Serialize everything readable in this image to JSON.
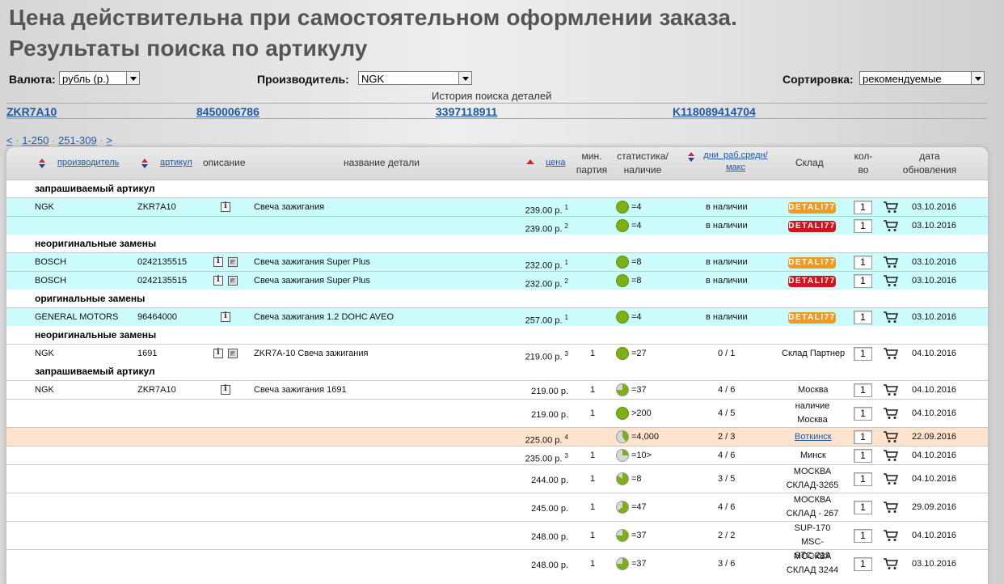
{
  "page": {
    "title_line1": "Цена действительна при самостоятельном оформлении заказа.",
    "title_line2": "Результаты поиска по артикулу"
  },
  "filters": {
    "currency_label": "Валюта:",
    "currency_value": "рубль (р.)",
    "manufacturer_label": "Производитель:",
    "manufacturer_value": "NGK",
    "sort_label": "Сортировка:",
    "sort_value": "рекомендуемые"
  },
  "history": {
    "title": "История поиска деталей",
    "items": [
      "ZKR7A10",
      "8450006786",
      "3397118911",
      "K118089414704"
    ]
  },
  "pager": {
    "prev": "<",
    "sep": "·",
    "pages": [
      "1-250",
      "251-309"
    ],
    "next": ">"
  },
  "table": {
    "headers": {
      "manufacturer": "производитель",
      "article": "артикул",
      "description": "описание",
      "name": "название детали",
      "price": "цена",
      "min_lot_1": "мин.",
      "min_lot_2": "партия",
      "stats_1": "статистика/",
      "stats_2": "наличие",
      "days_1": "дни_раб.средн/",
      "days_2": "макс",
      "warehouse": "Склад",
      "qty_1": "кол-",
      "qty_2": "во",
      "date_1": "дата",
      "date_2": "обновления"
    },
    "groups": [
      "запрашиваемый артикул",
      "неоригинальные замены",
      "оригинальные замены",
      "неоригинальные замены",
      "запрашиваемый артикул"
    ],
    "rows": [
      {
        "mfr": "NGK",
        "art": "ZKR7A10",
        "name": "Свеча зажигания",
        "price": "239.00 р.",
        "sup": "1",
        "lot": "",
        "stat": "=4",
        "days": "в наличии",
        "wh": "DETALI77",
        "qty": "1",
        "date": "03.10.2016"
      },
      {
        "mfr": "",
        "art": "",
        "name": "",
        "price": "239.00 р.",
        "sup": "2",
        "lot": "",
        "stat": "=4",
        "days": "в наличии",
        "wh": "DETALI77",
        "qty": "1",
        "date": "03.10.2016"
      },
      {
        "mfr": "BOSCH",
        "art": "0242135515",
        "name": "Свеча зажигания Super Plus",
        "price": "232.00 р.",
        "sup": "1",
        "lot": "",
        "stat": "=8",
        "days": "в наличии",
        "wh": "DETALI77",
        "qty": "1",
        "date": "03.10.2016"
      },
      {
        "mfr": "BOSCH",
        "art": "0242135515",
        "name": "Свеча зажигания Super Plus",
        "price": "232.00 р.",
        "sup": "2",
        "lot": "",
        "stat": "=8",
        "days": "в наличии",
        "wh": "DETALI77",
        "qty": "1",
        "date": "03.10.2016"
      },
      {
        "mfr": "GENERAL MOTORS",
        "art": "96464000",
        "name": "Свеча зажигания 1.2 DOHC AVEO",
        "price": "257.00 р.",
        "sup": "1",
        "lot": "",
        "stat": "=4",
        "days": "в наличии",
        "wh": "DETALI77",
        "qty": "1",
        "date": "03.10.2016"
      },
      {
        "mfr": "NGK",
        "art": "1691",
        "name": "ZKR7A-10 Свеча зажигания",
        "price": "219.00 р.",
        "sup": "3",
        "lot": "1",
        "stat": "=27",
        "days": "0 / 1",
        "wh": "Склад Партнер",
        "qty": "1",
        "date": "04.10.2016"
      },
      {
        "mfr": "NGK",
        "art": "ZKR7A10",
        "name": "Свеча зажигания 1691",
        "price": "219.00 р.",
        "sup": "",
        "lot": "1",
        "stat": "=37",
        "days": "4 / 6",
        "wh": "Москва",
        "qty": "1",
        "date": "04.10.2016"
      },
      {
        "mfr": "",
        "art": "",
        "name": "",
        "price": "219.00 р.",
        "sup": "",
        "lot": "1",
        "stat": ">200",
        "days": "4 / 5",
        "wh1": "наличие",
        "wh2": "Москва",
        "qty": "1",
        "date": "04.10.2016"
      },
      {
        "mfr": "",
        "art": "",
        "name": "",
        "price": "225.00 р.",
        "sup": "4",
        "lot": "",
        "stat": "=4,000",
        "days": "2 / 3",
        "wh": "Воткинск",
        "qty": "1",
        "date": "22.09.2016"
      },
      {
        "mfr": "",
        "art": "",
        "name": "",
        "price": "235.00 р.",
        "sup": "3",
        "lot": "1",
        "stat": "=10>",
        "days": "4 / 6",
        "wh": "Минск",
        "qty": "1",
        "date": "04.10.2016"
      },
      {
        "mfr": "",
        "art": "",
        "name": "",
        "price": "244.00 р.",
        "sup": "",
        "lot": "1",
        "stat": "=8",
        "days": "3 / 5",
        "wh1": "МОСКВА",
        "wh2": "СКЛАД-3265",
        "qty": "1",
        "date": "04.10.2016"
      },
      {
        "mfr": "",
        "art": "",
        "name": "",
        "price": "245.00 р.",
        "sup": "",
        "lot": "1",
        "stat": "=47",
        "days": "4 / 6",
        "wh1": "МОСКВА",
        "wh2": "СКЛАД - 267",
        "qty": "1",
        "date": "29.09.2016"
      },
      {
        "mfr": "",
        "art": "",
        "name": "",
        "price": "248.00 р.",
        "sup": "",
        "lot": "1",
        "stat": "=37",
        "days": "2 / 2",
        "wh1": "SUP-170 MSC-",
        "wh2": "STC-219",
        "qty": "1",
        "date": "04.10.2016"
      },
      {
        "mfr": "",
        "art": "",
        "name": "",
        "price": "248.00 р.",
        "sup": "",
        "lot": "1",
        "stat": "=37",
        "days": "3 / 6",
        "wh1": "МОСКВА",
        "wh2": "СКЛАД 3244",
        "qty": "1",
        "date": "03.10.2016"
      }
    ]
  },
  "colors": {
    "row_highlight": "#ccfbfb",
    "row_peach": "#ffe3cc",
    "badge_orange": "#f39a1e",
    "badge_red": "#d2161e",
    "stat_green": "#7cb016",
    "link": "#1c5aa6"
  }
}
